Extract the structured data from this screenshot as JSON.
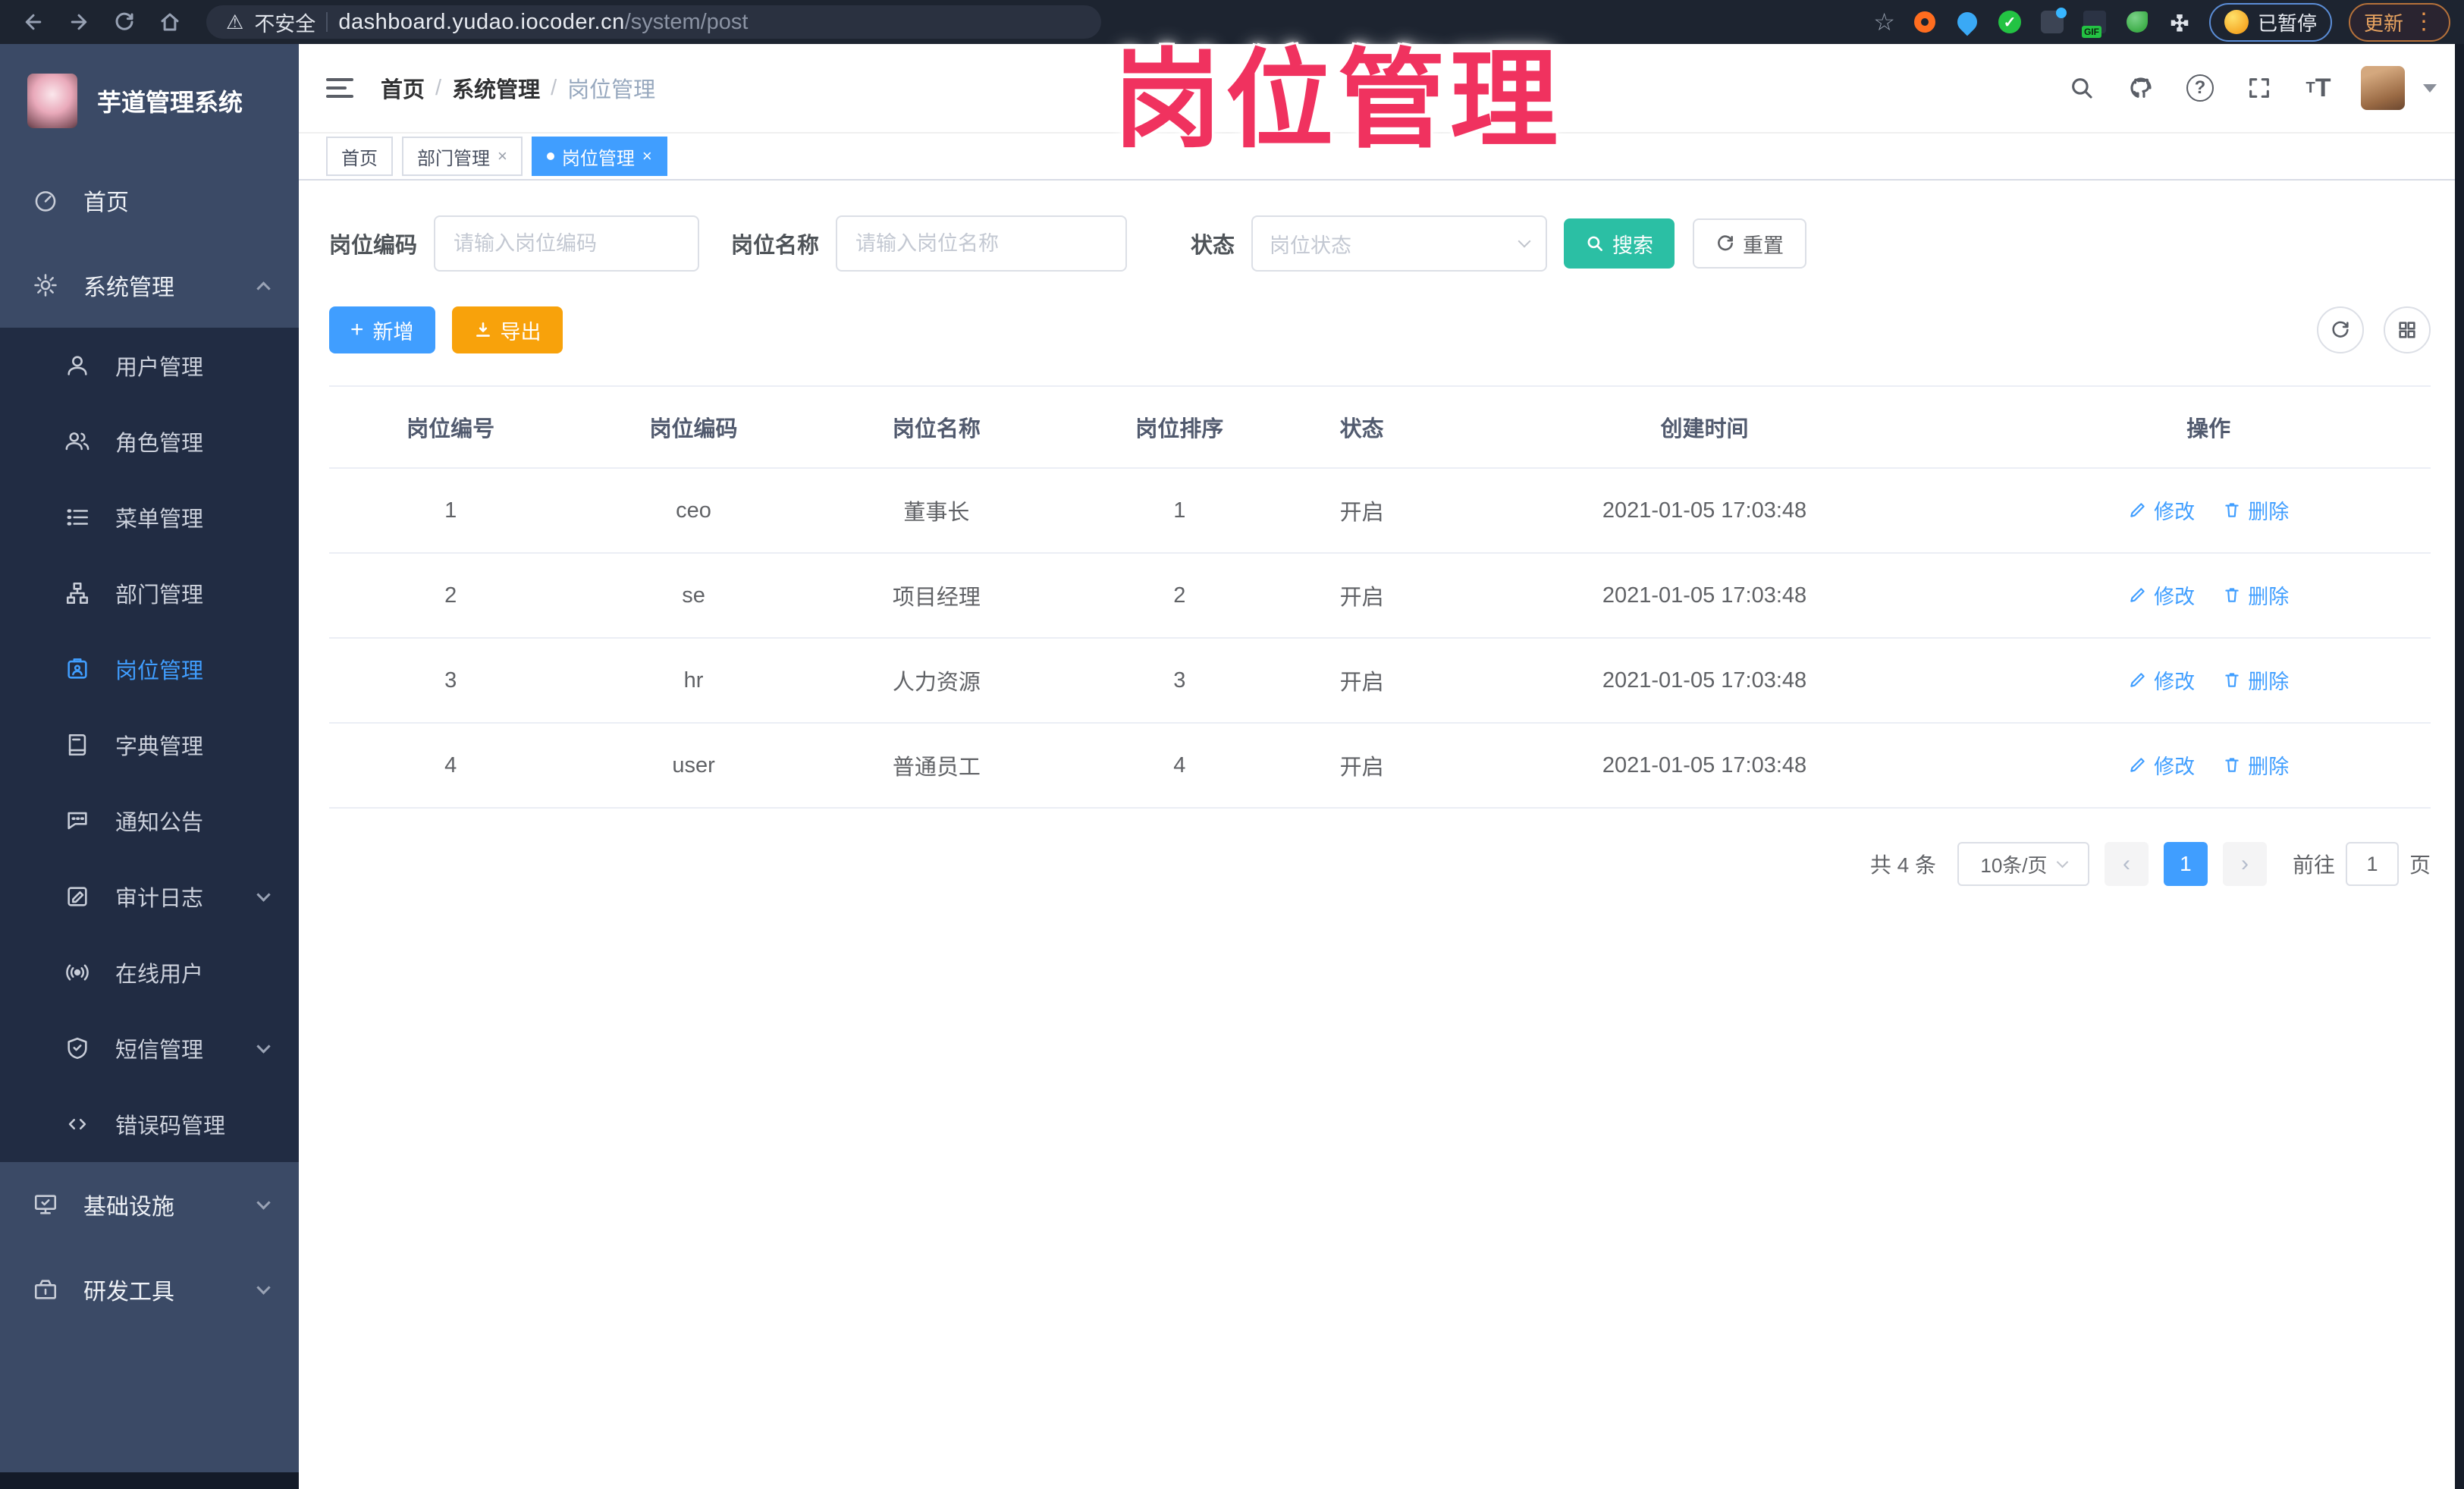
{
  "browser": {
    "security_label": "不安全",
    "url_host": "dashboard.yudao.iocoder.cn",
    "url_path": "/system/post",
    "ext_gif_label": "GIF",
    "paused_label": "已暂停",
    "update_label": "更新"
  },
  "annotation": {
    "title": "岗位管理"
  },
  "colors": {
    "accent_blue": "#409EFF",
    "search_teal": "#2BBFA4",
    "export_orange": "#F8A20B",
    "annotation_pink": "#F0325F",
    "sidebar_bg": "#3b4a66",
    "sidebar_sub_bg": "#212c43"
  },
  "sidebar": {
    "logo_title": "芋道管理系统",
    "items": [
      {
        "label": "首页",
        "icon": "dashboard-icon"
      },
      {
        "label": "系统管理",
        "icon": "gear-icon",
        "state": "expanded"
      },
      {
        "label": "用户管理",
        "icon": "user-icon"
      },
      {
        "label": "角色管理",
        "icon": "role-icon"
      },
      {
        "label": "菜单管理",
        "icon": "menu-list-icon"
      },
      {
        "label": "部门管理",
        "icon": "org-tree-icon"
      },
      {
        "label": "岗位管理",
        "icon": "post-badge-icon",
        "state": "active"
      },
      {
        "label": "字典管理",
        "icon": "dictionary-icon"
      },
      {
        "label": "通知公告",
        "icon": "announcement-icon"
      },
      {
        "label": "审计日志",
        "icon": "audit-log-icon",
        "state": "collapsed"
      },
      {
        "label": "在线用户",
        "icon": "online-users-icon"
      },
      {
        "label": "短信管理",
        "icon": "sms-shield-icon",
        "state": "collapsed"
      },
      {
        "label": "错误码管理",
        "icon": "error-code-icon"
      },
      {
        "label": "基础设施",
        "icon": "infrastructure-icon",
        "state": "collapsed"
      },
      {
        "label": "研发工具",
        "icon": "dev-tools-icon",
        "state": "collapsed"
      }
    ]
  },
  "navbar": {
    "breadcrumb": [
      "首页",
      "系统管理",
      "岗位管理"
    ],
    "separator": "/"
  },
  "tabs": [
    {
      "label": "首页",
      "closable": false,
      "active": false
    },
    {
      "label": "部门管理",
      "closable": true,
      "active": false
    },
    {
      "label": "岗位管理",
      "closable": true,
      "active": true
    }
  ],
  "filters": {
    "code_label": "岗位编码",
    "code_placeholder": "请输入岗位编码",
    "name_label": "岗位名称",
    "name_placeholder": "请输入岗位名称",
    "status_label": "状态",
    "status_placeholder": "岗位状态",
    "search_label": "搜索",
    "reset_label": "重置"
  },
  "toolbar": {
    "add_label": "新增",
    "export_label": "导出"
  },
  "table": {
    "headers": [
      "岗位编号",
      "岗位编码",
      "岗位名称",
      "岗位排序",
      "状态",
      "创建时间",
      "操作"
    ],
    "rows": [
      [
        "1",
        "ceo",
        "董事长",
        "1",
        "开启",
        "2021-01-05 17:03:48"
      ],
      [
        "2",
        "se",
        "项目经理",
        "2",
        "开启",
        "2021-01-05 17:03:48"
      ],
      [
        "3",
        "hr",
        "人力资源",
        "3",
        "开启",
        "2021-01-05 17:03:48"
      ],
      [
        "4",
        "user",
        "普通员工",
        "4",
        "开启",
        "2021-01-05 17:03:48"
      ]
    ],
    "edit_label": "修改",
    "delete_label": "删除"
  },
  "pagination": {
    "total": "共 4 条",
    "page_size": "10条/页",
    "current_page": "1",
    "goto_label": "前往",
    "goto_value": "1",
    "page_unit": "页"
  }
}
